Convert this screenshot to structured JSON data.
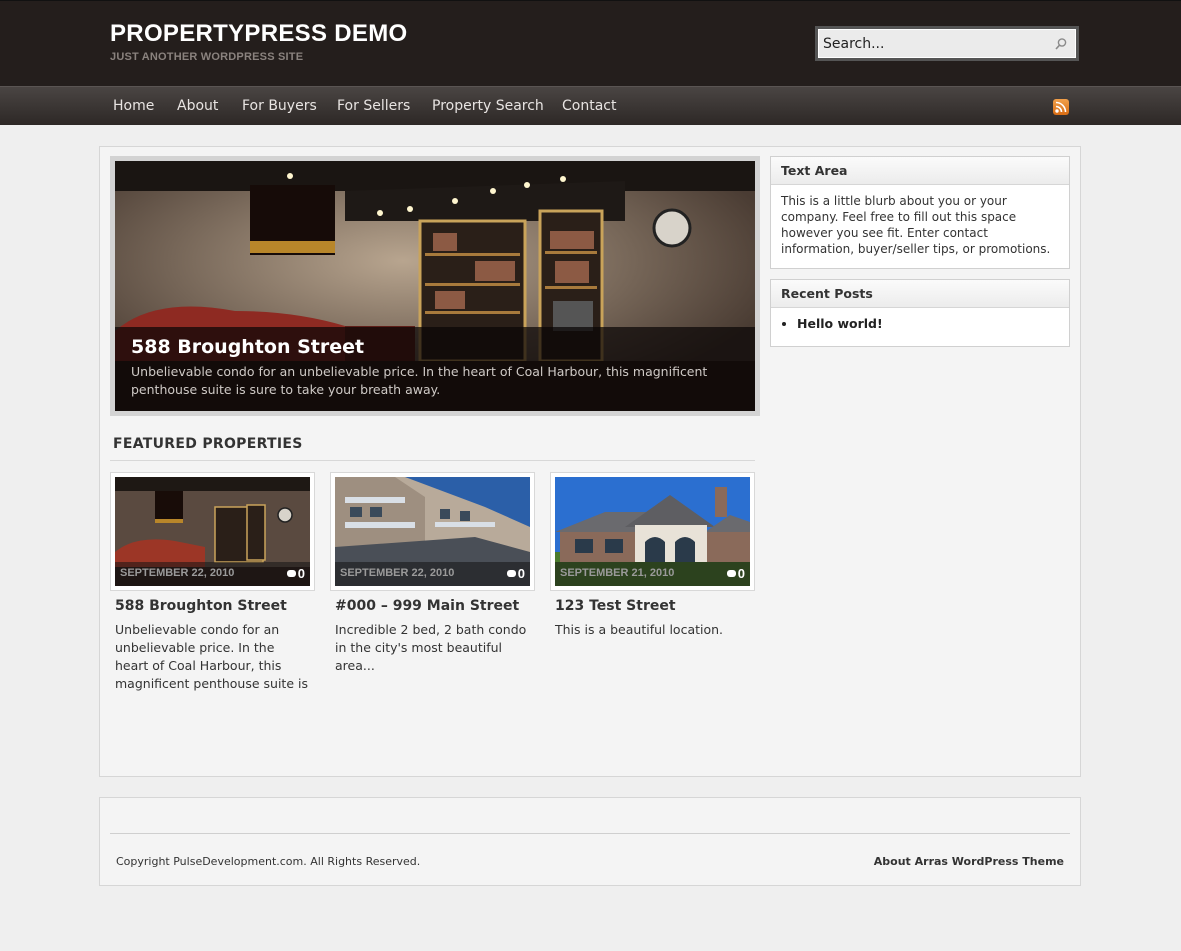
{
  "header": {
    "site_title": "PROPERTYPRESS DEMO",
    "tagline": "JUST ANOTHER WORDPRESS SITE",
    "search_placeholder": "Search..."
  },
  "nav": {
    "items": [
      "Home",
      "About",
      "For Buyers",
      "For Sellers",
      "Property Search",
      "Contact"
    ]
  },
  "featured_slide": {
    "title": "588 Broughton Street",
    "text": "Unbelievable condo for an unbelievable price. In the heart of Coal Harbour, this magnificent penthouse suite is sure to take your breath away."
  },
  "featured_properties": {
    "heading": "FEATURED PROPERTIES",
    "items": [
      {
        "date": "SEPTEMBER 22, 2010",
        "comments": "0",
        "title": "588 Broughton Street",
        "excerpt": "Unbelievable condo for an unbelievable price. In the heart of Coal Harbour, this magnificent penthouse suite is"
      },
      {
        "date": "SEPTEMBER 22, 2010",
        "comments": "0",
        "title": "#000 – 999 Main Street",
        "excerpt": "Incredible 2 bed, 2 bath condo in the city's most beautiful area..."
      },
      {
        "date": "SEPTEMBER 21, 2010",
        "comments": "0",
        "title": "123 Test Street",
        "excerpt": "This is a beautiful location."
      }
    ]
  },
  "sidebar": {
    "text_area": {
      "title": "Text Area",
      "body": "This is a little blurb about you or your company. Feel free to fill out this space however you see fit. Enter contact information, buyer/seller tips, or promotions."
    },
    "recent_posts": {
      "title": "Recent Posts",
      "items": [
        "Hello world!"
      ]
    }
  },
  "footer": {
    "copyright": "Copyright PulseDevelopment.com. All Rights Reserved.",
    "theme_link": "About Arras WordPress Theme"
  },
  "icons": {
    "search": "search-icon",
    "rss": "rss-icon",
    "comment": "comment-icon"
  },
  "colors": {
    "header_bg": "#241e1c",
    "nav_bg": "#2d2826",
    "rss": "#e07a22",
    "page_bg": "#efefef"
  }
}
